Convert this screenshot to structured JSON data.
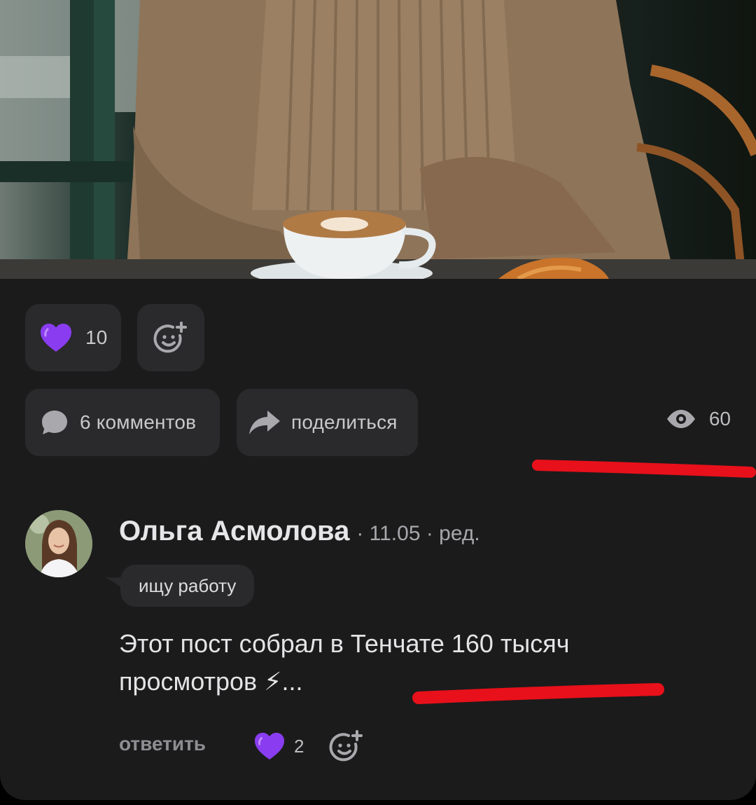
{
  "post": {
    "likes_count": "10",
    "comments_label": "6 комментов",
    "share_label": "поделиться",
    "views_count": "60"
  },
  "comment": {
    "author": "Ольга Асмолова",
    "meta": "· 11.05 · ред.",
    "status": "ищу работу",
    "text": "Этот пост собрал в Тенчате 160 тысяч просмотров ⚡...",
    "reply_label": "ответить",
    "likes_count": "2"
  },
  "icons": {
    "heart": "purple-heart-icon",
    "add_reaction": "add-reaction-icon",
    "comment": "comment-bubble-icon",
    "share": "share-arrow-icon",
    "views": "eye-icon"
  },
  "colors": {
    "background": "#1b1b1c",
    "pill": "#2a2a2c",
    "heart": "#8a3df0",
    "annotation": "#e8101a"
  }
}
